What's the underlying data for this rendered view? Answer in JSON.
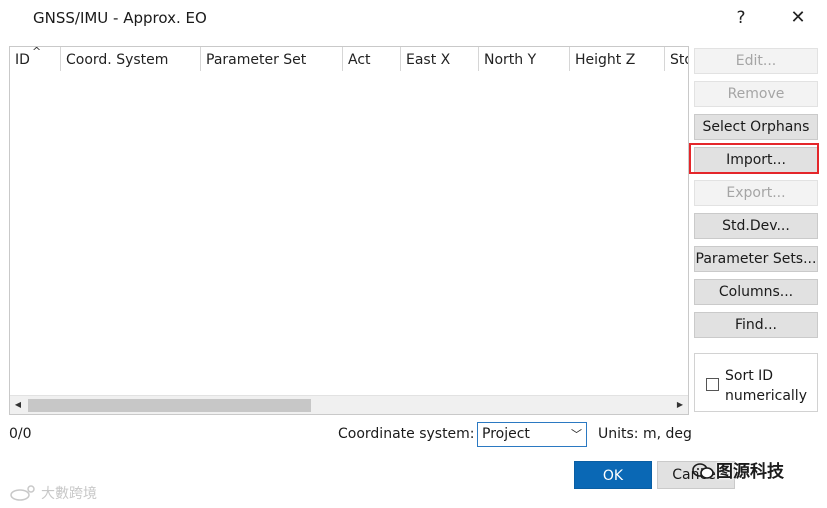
{
  "window": {
    "title": "GNSS/IMU - Approx. EO",
    "help_label": "?",
    "close_label": "✕"
  },
  "grid": {
    "columns": [
      "ID",
      "Coord. System",
      "Parameter Set",
      "Act",
      "East X",
      "North Y",
      "Height Z",
      "Std"
    ],
    "sort_indicator": "^",
    "rows": []
  },
  "buttons": {
    "edit": "Edit...",
    "remove": "Remove",
    "select_orphans": "Select Orphans",
    "import": "Import...",
    "export": "Export...",
    "std_dev": "Std.Dev...",
    "parameter_sets": "Parameter Sets...",
    "columns": "Columns...",
    "find": "Find..."
  },
  "sort_option": {
    "label_line1": "Sort ID",
    "label_line2": "numerically",
    "checked": false
  },
  "footer": {
    "count": "0/0",
    "coord_label": "Coordinate system:",
    "coord_value": "Project",
    "units": "Units: m, deg",
    "ok": "OK",
    "cancel": "Cancel"
  },
  "watermarks": {
    "right": "图源科技",
    "left": "大數跨境"
  },
  "colors": {
    "ok_button": "#0a68b5",
    "highlight_frame": "#e4262a",
    "select_border": "#2b79c2"
  }
}
